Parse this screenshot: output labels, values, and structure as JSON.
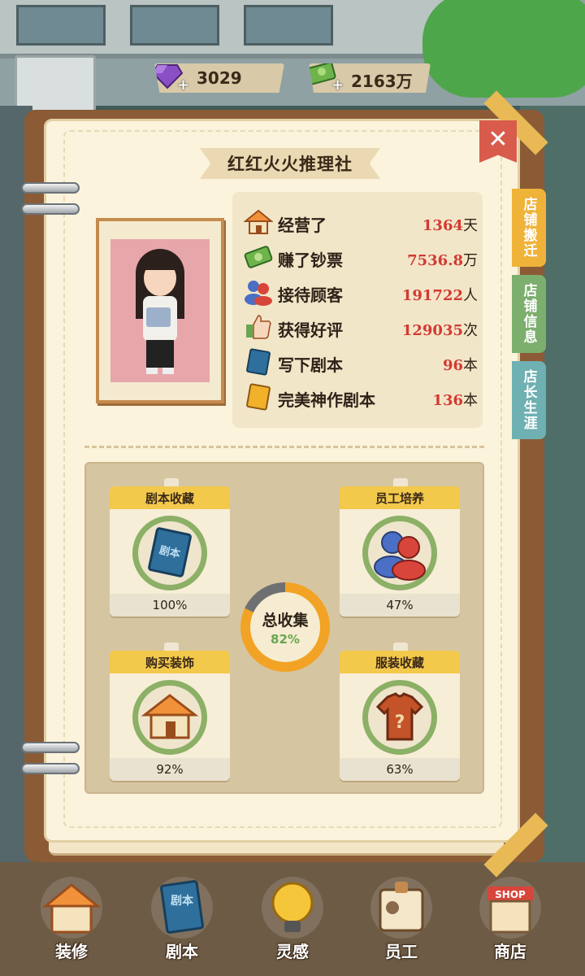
{
  "currency": {
    "gems": "3029",
    "cash": "2163万"
  },
  "shop_name": "红红火火推理社",
  "tabs": [
    {
      "label": "店铺搬迁",
      "color": "#f0b33a"
    },
    {
      "label": "店铺信息",
      "color": "#7cae6e"
    },
    {
      "label": "店长生涯",
      "color": "#6fb0b2"
    }
  ],
  "stats": [
    {
      "icon": "house-icon",
      "label": "经营了",
      "value": "1364",
      "unit": "天"
    },
    {
      "icon": "money-icon",
      "label": "赚了钞票",
      "value": "7536.8",
      "unit": "万"
    },
    {
      "icon": "customers-icon",
      "label": "接待顾客",
      "value": "191722",
      "unit": "人"
    },
    {
      "icon": "thumbs-up-icon",
      "label": "获得好评",
      "value": "129035",
      "unit": "次"
    },
    {
      "icon": "script-book-icon",
      "label": "写下剧本",
      "value": "96",
      "unit": "本"
    },
    {
      "icon": "gold-script-icon",
      "label": "完美神作剧本",
      "value": "136",
      "unit": "本"
    }
  ],
  "collections": [
    {
      "title": "剧本收藏",
      "percent": "100%",
      "progress": 1.0
    },
    {
      "title": "员工培养",
      "percent": "47%",
      "progress": 0.47
    },
    {
      "title": "购买装饰",
      "percent": "92%",
      "progress": 0.92
    },
    {
      "title": "服装收藏",
      "percent": "63%",
      "progress": 0.63
    }
  ],
  "book_icon_text": "剧本",
  "total": {
    "label": "总收集",
    "value": "82%",
    "progress": 0.82
  },
  "nav": [
    {
      "label": "装修",
      "icon": "renovate-icon"
    },
    {
      "label": "剧本",
      "icon": "script-icon"
    },
    {
      "label": "灵感",
      "icon": "lightbulb-icon"
    },
    {
      "label": "员工",
      "icon": "staff-badge-icon"
    },
    {
      "label": "商店",
      "icon": "shop-icon"
    }
  ],
  "nav_book_text": "剧本",
  "nav_shop_text": "SHOP",
  "colors": {
    "accent": "#f3c94c",
    "value_red": "#d33a32",
    "progress_green": "#8bb066",
    "close_red": "#d95b4c"
  }
}
